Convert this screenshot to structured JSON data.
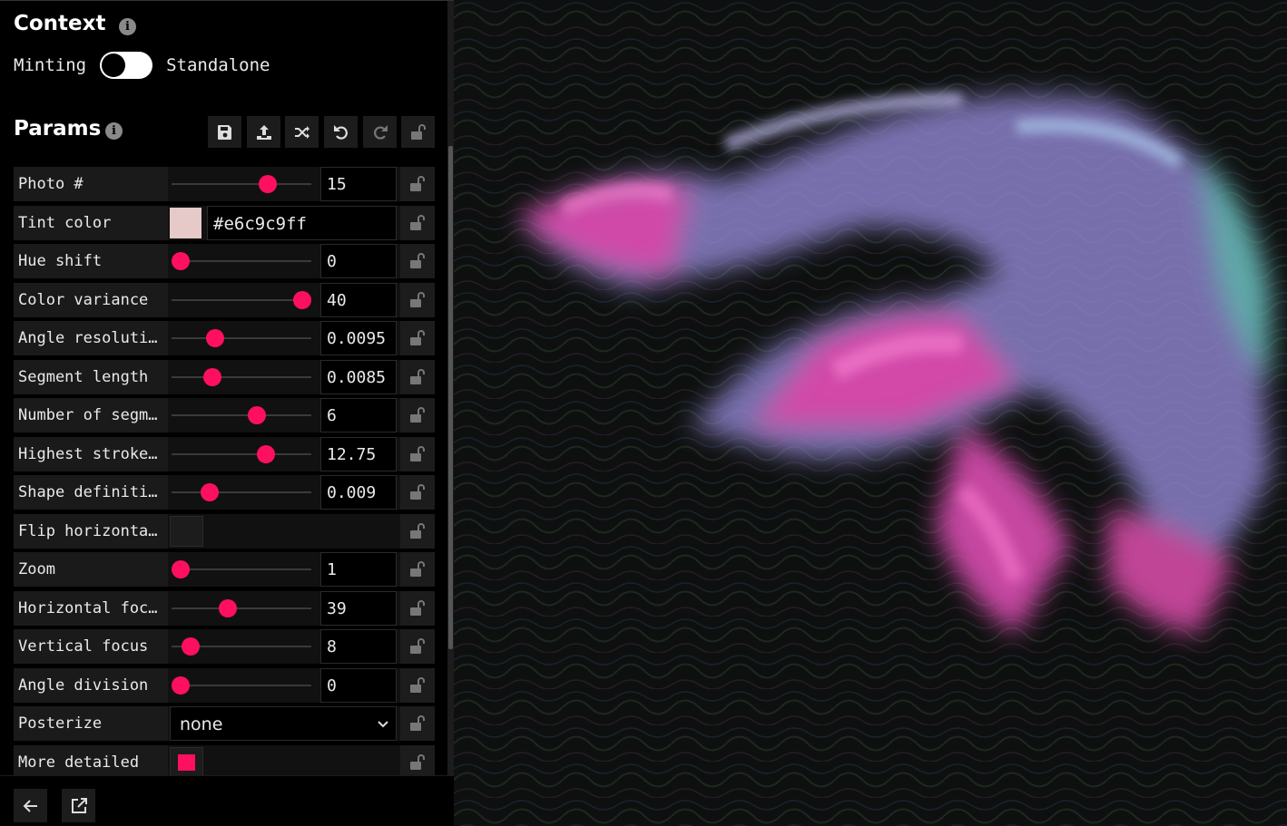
{
  "context": {
    "title": "Context",
    "left_label": "Minting",
    "right_label": "Standalone"
  },
  "params": {
    "title": "Params",
    "toolbar": [
      "save-icon",
      "upload-icon",
      "shuffle-icon",
      "undo-icon",
      "redo-icon",
      "lock-open-icon"
    ],
    "rows": [
      {
        "label": "Photo #",
        "type": "slider",
        "value": "15",
        "fraction": 0.72
      },
      {
        "label": "Tint color",
        "type": "color",
        "value": "#e6c9c9ff",
        "color": "#e6c9c9"
      },
      {
        "label": "Hue shift",
        "type": "slider",
        "value": "0",
        "fraction": 0.0
      },
      {
        "label": "Color variance",
        "type": "slider",
        "value": "40",
        "fraction": 1.0
      },
      {
        "label": "Angle resoluti…",
        "type": "slider",
        "value": "0.0095",
        "fraction": 0.28
      },
      {
        "label": "Segment length",
        "type": "slider",
        "value": "0.0085",
        "fraction": 0.26
      },
      {
        "label": "Number of segm…",
        "type": "slider",
        "value": "6",
        "fraction": 0.63
      },
      {
        "label": "Highest stroke…",
        "type": "slider",
        "value": "12.75",
        "fraction": 0.7
      },
      {
        "label": "Shape definiti…",
        "type": "slider",
        "value": "0.009",
        "fraction": 0.24
      },
      {
        "label": "Flip horizonta…",
        "type": "checkbox",
        "checked": false
      },
      {
        "label": "Zoom",
        "type": "slider",
        "value": "1",
        "fraction": 0.0
      },
      {
        "label": "Horizontal foc…",
        "type": "slider",
        "value": "39",
        "fraction": 0.39
      },
      {
        "label": "Vertical focus",
        "type": "slider",
        "value": "8",
        "fraction": 0.08
      },
      {
        "label": "Angle division",
        "type": "slider",
        "value": "0",
        "fraction": 0.0
      },
      {
        "label": "Posterize",
        "type": "select",
        "value": "none"
      },
      {
        "label": "More detailed",
        "type": "checkbox",
        "checked": true
      }
    ]
  },
  "bottom": {
    "buttons": [
      "arrow-left-icon",
      "external-link-icon"
    ]
  },
  "colors": {
    "accent": "#ff0f5f",
    "panel_bg": "#000000",
    "row_bg": "#1a1a1a"
  }
}
